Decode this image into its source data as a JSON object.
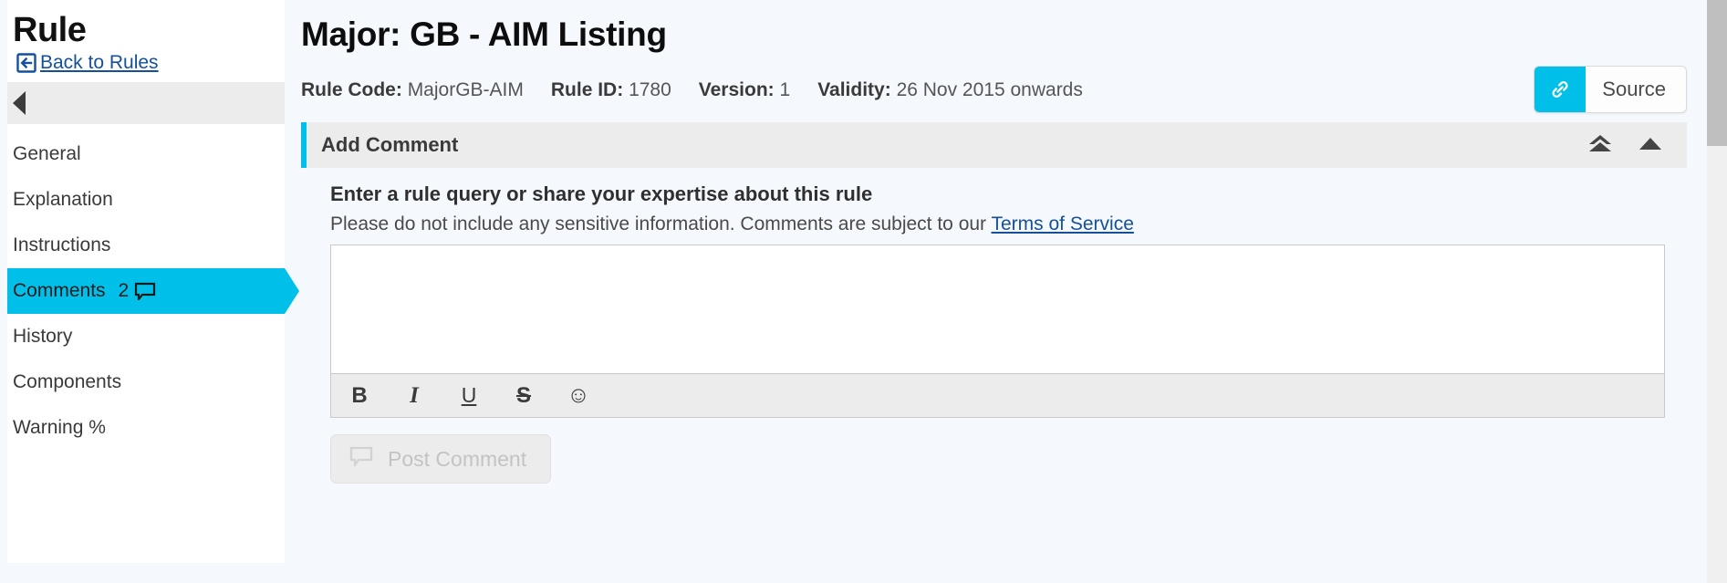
{
  "sidebar": {
    "title": "Rule",
    "back_link": "Back to Rules",
    "back_icon": "back-arrow-icon",
    "collapse_icon": "collapse-left-caret-icon",
    "items": [
      {
        "label": "General",
        "active": false
      },
      {
        "label": "Explanation",
        "active": false
      },
      {
        "label": "Instructions",
        "active": false
      },
      {
        "label": "Comments",
        "active": true,
        "count": "2",
        "icon": "comment-bubble-icon"
      },
      {
        "label": "History",
        "active": false
      },
      {
        "label": "Components",
        "active": false
      },
      {
        "label": "Warning %",
        "active": false
      }
    ]
  },
  "header": {
    "page_title": "Major: GB - AIM Listing",
    "meta": [
      {
        "label": "Rule Code:",
        "value": "MajorGB-AIM"
      },
      {
        "label": "Rule ID:",
        "value": "1780"
      },
      {
        "label": "Version:",
        "value": "1"
      },
      {
        "label": "Validity:",
        "value": "26 Nov 2015 onwards"
      }
    ],
    "source_button": {
      "label": "Source",
      "icon": "link-icon"
    }
  },
  "comment_panel": {
    "header_title": "Add Comment",
    "collapse_all_icon": "double-chevron-up-icon",
    "collapse_icon": "triangle-up-icon",
    "field_label": "Enter a rule query or share your expertise about this rule",
    "help_text": "Please do not include any sensitive information. Comments are subject to our ",
    "terms_link": "Terms of Service",
    "editor_value": "",
    "editor_placeholder": "",
    "toolbar": [
      {
        "name": "bold-button",
        "glyph": "B"
      },
      {
        "name": "italic-button",
        "glyph": "I"
      },
      {
        "name": "underline-button",
        "glyph": "U"
      },
      {
        "name": "strikethrough-button",
        "glyph": "S"
      },
      {
        "name": "emoji-button",
        "glyph": "☺"
      }
    ],
    "post_button": {
      "label": "Post Comment",
      "icon": "comment-bubble-icon",
      "disabled": true
    }
  },
  "colors": {
    "accent": "#00c0ea",
    "link": "#14509b",
    "page_bg": "#f5f8fd",
    "panel_header_bg": "#ececec"
  }
}
